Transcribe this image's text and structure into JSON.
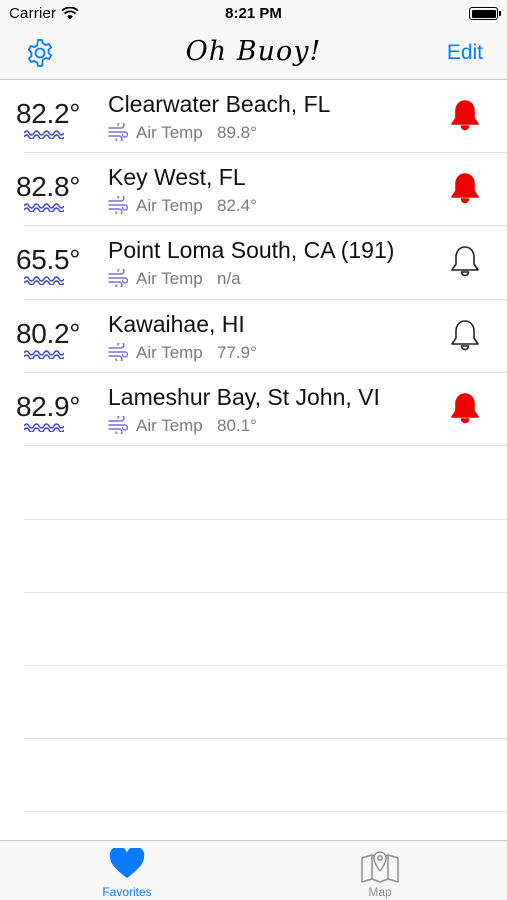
{
  "status_bar": {
    "carrier": "Carrier",
    "time": "8:21 PM"
  },
  "nav": {
    "title": "Oh Buoy!",
    "edit_label": "Edit"
  },
  "buoys": [
    {
      "water_temp": "82.2°",
      "name": "Clearwater Beach, FL",
      "air_label": "Air Temp",
      "air_temp": "89.8°",
      "alert_on": true
    },
    {
      "water_temp": "82.8°",
      "name": "Key West, FL",
      "air_label": "Air Temp",
      "air_temp": "82.4°",
      "alert_on": true
    },
    {
      "water_temp": "65.5°",
      "name": "Point Loma South, CA  (191)",
      "air_label": "Air Temp",
      "air_temp": "n/a",
      "alert_on": false
    },
    {
      "water_temp": "80.2°",
      "name": "Kawaihae, HI",
      "air_label": "Air Temp",
      "air_temp": "77.9°",
      "alert_on": false
    },
    {
      "water_temp": "82.9°",
      "name": "Lameshur Bay, St John, VI",
      "air_label": "Air Temp",
      "air_temp": "80.1°",
      "alert_on": true
    }
  ],
  "tabs": [
    {
      "label": "Favorites",
      "selected": true
    },
    {
      "label": "Map",
      "selected": false
    }
  ],
  "colors": {
    "accent": "#0a7aff",
    "alert_red": "#ee0000",
    "wave_blue": "#3a3fd8",
    "wind_purple": "#7b6fd6",
    "secondary_text": "#7a7a7a"
  }
}
